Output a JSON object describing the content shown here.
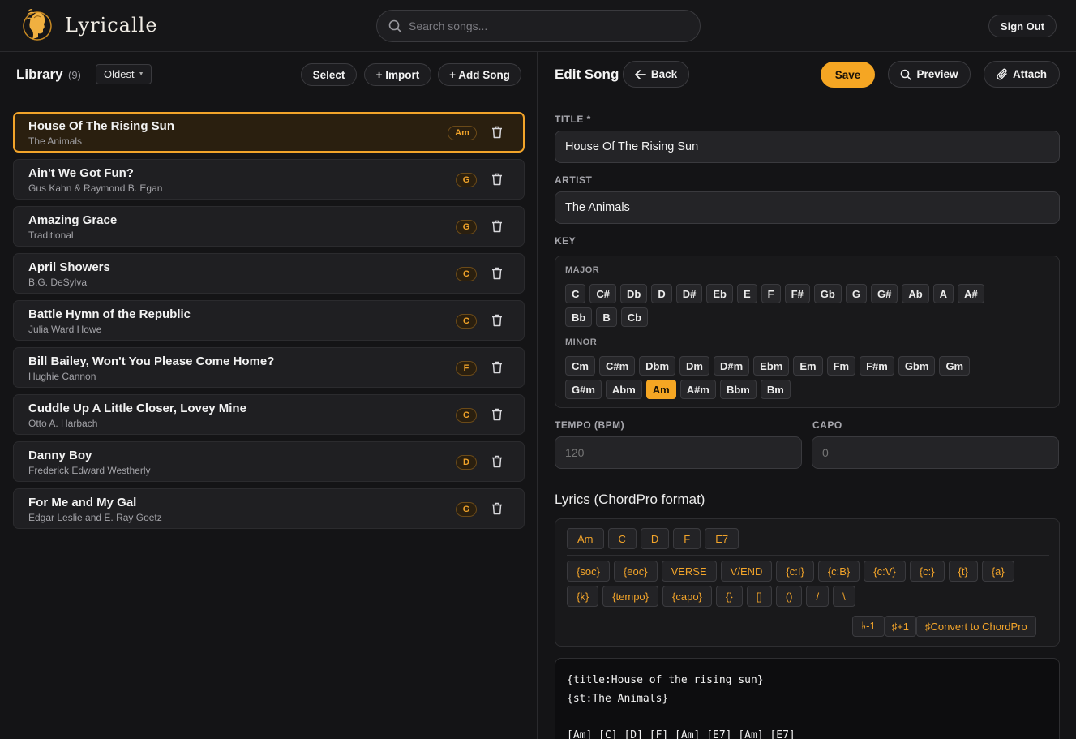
{
  "app": {
    "name": "Lyricalle"
  },
  "search": {
    "placeholder": "Search songs..."
  },
  "header": {
    "sign_out_label": "Sign Out"
  },
  "library": {
    "title": "Library",
    "count": "(9)",
    "sort_value": "Oldest",
    "select_label": "Select",
    "import_label": "+ Import",
    "add_label": "+ Add Song",
    "songs": [
      {
        "title": "House Of The Rising Sun",
        "artist": "The Animals",
        "key": "Am"
      },
      {
        "title": "Ain't We Got Fun?",
        "artist": "Gus Kahn & Raymond B. Egan",
        "key": "G"
      },
      {
        "title": "Amazing Grace",
        "artist": "Traditional",
        "key": "G"
      },
      {
        "title": "April Showers",
        "artist": "B.G. DeSylva",
        "key": "C"
      },
      {
        "title": "Battle Hymn of the Republic",
        "artist": "Julia Ward Howe",
        "key": "C"
      },
      {
        "title": "Bill Bailey, Won't You Please Come Home?",
        "artist": "Hughie Cannon",
        "key": "F"
      },
      {
        "title": "Cuddle Up A Little Closer, Lovey Mine",
        "artist": "Otto A. Harbach",
        "key": "C"
      },
      {
        "title": "Danny Boy",
        "artist": "Frederick Edward Westherly",
        "key": "D"
      },
      {
        "title": "For Me and My Gal",
        "artist": "Edgar Leslie and E. Ray Goetz",
        "key": "G"
      }
    ]
  },
  "editor": {
    "title": "Edit Song",
    "back_label": "Back",
    "save_label": "Save",
    "preview_label": "Preview",
    "attach_label": "Attach",
    "title_label": "TITLE *",
    "title_value": "House Of The Rising Sun",
    "artist_label": "ARTIST",
    "artist_value": "The Animals",
    "key_label": "KEY",
    "major_label": "MAJOR",
    "minor_label": "MINOR",
    "major_keys_row1": [
      "C",
      "C#",
      "Db",
      "D",
      "D#",
      "Eb",
      "E",
      "F",
      "F#",
      "Gb",
      "G",
      "G#",
      "Ab",
      "A",
      "A#"
    ],
    "major_keys_row2": [
      "Bb",
      "B",
      "Cb"
    ],
    "minor_keys_row1": [
      "Cm",
      "C#m",
      "Dbm",
      "Dm",
      "D#m",
      "Ebm",
      "Em",
      "Fm",
      "F#m",
      "Gbm",
      "Gm"
    ],
    "minor_keys_row2": [
      "G#m",
      "Abm",
      "Am",
      "A#m",
      "Bbm",
      "Bm"
    ],
    "selected_key": "Am",
    "tempo_label": "TEMPO (BPM)",
    "tempo_placeholder": "120",
    "capo_label": "CAPO",
    "capo_placeholder": "0",
    "lyrics_label": "Lyrics (ChordPro format)",
    "chord_buttons": [
      "Am",
      "C",
      "D",
      "F",
      "E7"
    ],
    "directive_row1": [
      "{soc}",
      "{eoc}",
      "VERSE",
      "V/END",
      "{c:I}",
      "{c:B}",
      "{c:V}",
      "{c:}",
      "{t}",
      "{a}"
    ],
    "directive_row2": [
      "{k}",
      "{tempo}",
      "{capo}",
      "{}",
      "[]",
      "()",
      "/",
      "\\"
    ],
    "transpose_down": "♭-1",
    "transpose_up": "♯+1",
    "convert_label": "♯Convert to ChordPro",
    "lyrics_text": "{title:House of the rising sun}\n{st:The Animals}\n\n[Am] [C] [D] [F] [Am] [E7] [Am] [E7]"
  },
  "colors": {
    "accent": "#f5a623",
    "background": "#141416",
    "panel": "#1f1f22"
  }
}
